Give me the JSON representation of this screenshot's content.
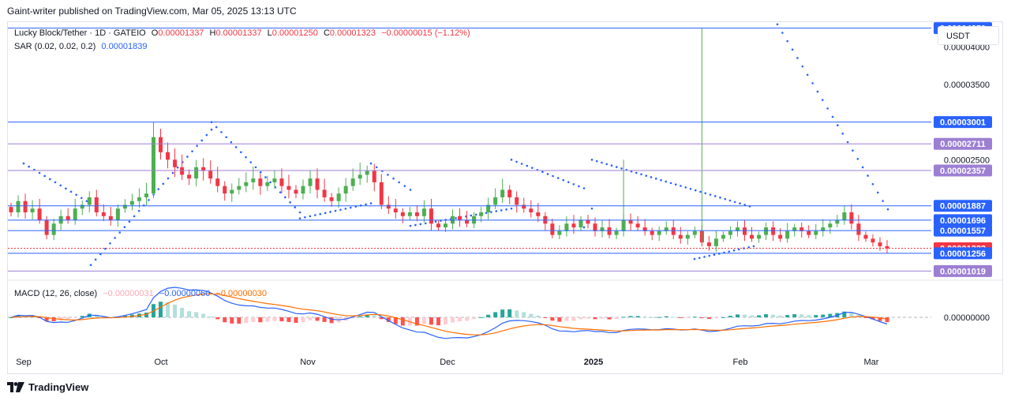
{
  "publisher_line": "Gaint-writer published on TradingView.com, Mar 05, 2025 13:13 UTC",
  "currency": "USDT",
  "brand": "TradingView",
  "colors": {
    "up": "#089981",
    "up_candle": "#4caf50",
    "down": "#f23645",
    "line_blue": "#2962ff",
    "line_purple": "#9c7fd3",
    "macd_line": "#2962ff",
    "signal_line": "#ff6d00",
    "hist_up_strong": "#26a69a",
    "hist_up_weak": "#b2dfdb",
    "hist_down_strong": "#ff5252",
    "hist_down_weak": "#ffcdd2"
  },
  "legend": {
    "symbol": "Lucky Block/Tether · 1D · GATEIO",
    "o_label": "O",
    "o_value": "0.00001337",
    "h_label": "H",
    "h_value": "0.00001337",
    "l_label": "L",
    "l_value": "0.00001250",
    "c_label": "C",
    "c_value": "0.00001323",
    "change": "−0.00000015 (−1.12%)",
    "sar_label": "SAR (0.02, 0.02, 0.2)",
    "sar_value": "0.00001839",
    "macd_label": "MACD (12, 26, close)",
    "macd_hist": "−0.00000031",
    "macd_value": "−0.00000060",
    "signal_value": "−0.00000030"
  },
  "chart_data": [
    {
      "type": "candlestick",
      "symbol": "Lucky Block/Tether",
      "timeframe": "1D",
      "exchange": "GATEIO",
      "x_tick_labels": [
        "Sep",
        "Oct",
        "Nov",
        "Dec",
        "2025",
        "Feb",
        "Mar"
      ],
      "y_tick_labels": [
        "0.00004000",
        "0.00003500",
        "0.00002500"
      ],
      "ylim": [
        9.5e-06,
        4.33e-05
      ],
      "last_ohlc": {
        "open": 1.337e-05,
        "high": 1.337e-05,
        "low": 1.25e-05,
        "close": 1.323e-05
      },
      "horizontal_levels": [
        {
          "value": 4.25e-05,
          "label": "0.00004250",
          "color": "#2962ff"
        },
        {
          "value": 3.001e-05,
          "label": "0.00003001",
          "color": "#2962ff"
        },
        {
          "value": 2.711e-05,
          "label": "0.00002711",
          "color": "#9c7fd3"
        },
        {
          "value": 2.357e-05,
          "label": "0.00002357",
          "color": "#9c7fd3"
        },
        {
          "value": 1.887e-05,
          "label": "0.00001887",
          "color": "#2962ff"
        },
        {
          "value": 1.696e-05,
          "label": "0.00001696",
          "color": "#2962ff"
        },
        {
          "value": 1.557e-05,
          "label": "0.00001557",
          "color": "#2962ff"
        },
        {
          "value": 1.323e-05,
          "label": "0.00001323",
          "color": "#f23645"
        },
        {
          "value": 1.256e-05,
          "label": "0.00001256",
          "color": "#2962ff"
        },
        {
          "value": 1.019e-05,
          "label": "0.00001019",
          "color": "#9c7fd3"
        }
      ],
      "close_series_approx": [
        1.8e-05,
        1.95e-05,
        1.8e-05,
        1.85e-05,
        1.7e-05,
        1.5e-05,
        1.65e-05,
        1.75e-05,
        1.7e-05,
        1.85e-05,
        1.9e-05,
        2e-05,
        1.8e-05,
        1.75e-05,
        1.7e-05,
        1.85e-05,
        1.9e-05,
        1.95e-05,
        2e-05,
        2.05e-05,
        2.8e-05,
        2.6e-05,
        2.5e-05,
        2.4e-05,
        2.3e-05,
        2.25e-05,
        2.4e-05,
        2.35e-05,
        2.25e-05,
        2.15e-05,
        2.05e-05,
        2.1e-05,
        2.15e-05,
        2.2e-05,
        2.25e-05,
        2.15e-05,
        2.2e-05,
        2.25e-05,
        2.15e-05,
        2.1e-05,
        2.05e-05,
        2.15e-05,
        2.25e-05,
        2.1e-05,
        2e-05,
        1.95e-05,
        2.05e-05,
        2.15e-05,
        2.25e-05,
        2.3e-05,
        2.35e-05,
        2.2e-05,
        1.9e-05,
        1.85e-05,
        1.8e-05,
        1.75e-05,
        1.8e-05,
        1.75e-05,
        1.85e-05,
        1.65e-05,
        1.6e-05,
        1.65e-05,
        1.75e-05,
        1.7e-05,
        1.65e-05,
        1.75e-05,
        1.8e-05,
        1.9e-05,
        2e-05,
        2.1e-05,
        2e-05,
        1.9e-05,
        1.85e-05,
        1.8e-05,
        1.75e-05,
        1.65e-05,
        1.5e-05,
        1.55e-05,
        1.65e-05,
        1.6e-05,
        1.7e-05,
        1.65e-05,
        1.55e-05,
        1.6e-05,
        1.5e-05,
        1.55e-05,
        1.7e-05,
        1.65e-05,
        1.6e-05,
        1.55e-05,
        1.5e-05,
        1.55e-05,
        1.6e-05,
        1.5e-05,
        1.45e-05,
        1.5e-05,
        1.55e-05,
        1.4e-05,
        1.35e-05,
        1.45e-05,
        1.5e-05,
        1.55e-05,
        1.6e-05,
        1.5e-05,
        1.45e-05,
        1.5e-05,
        1.6e-05,
        1.5e-05,
        1.45e-05,
        1.55e-05,
        1.6e-05,
        1.55e-05,
        1.5e-05,
        1.55e-05,
        1.6e-05,
        1.65e-05,
        1.7e-05,
        1.8e-05,
        1.65e-05,
        1.5e-05,
        1.45e-05,
        1.4e-05,
        1.35e-05,
        1.32e-05
      ],
      "sar_segments": [
        {
          "from": 2.45e-05,
          "to": 1.95e-05,
          "position": "above"
        },
        {
          "from": 1.1e-05,
          "to": 2.9e-05,
          "position": "below"
        },
        {
          "from": 3e-05,
          "to": 1.8e-05,
          "position": "above"
        },
        {
          "from": 1.72e-05,
          "to": 1.92e-05,
          "position": "below"
        },
        {
          "from": 2.45e-05,
          "to": 2.1e-05,
          "position": "above"
        },
        {
          "from": 1.62e-05,
          "to": 1.85e-05,
          "position": "below"
        },
        {
          "from": 2.5e-05,
          "to": 2.12e-05,
          "position": "above"
        },
        {
          "from": 1.6e-05,
          "to": 1.85e-05,
          "position": "below"
        },
        {
          "from": 2.5e-05,
          "to": 1.88e-05,
          "position": "above"
        },
        {
          "from": 1.18e-05,
          "to": 1.35e-05,
          "position": "below"
        },
        {
          "from": 4.3e-05,
          "to": 1.84e-05,
          "position": "above"
        }
      ]
    },
    {
      "type": "macd",
      "params": "12, 26, close",
      "y_tick_labels": [
        "0.00000000"
      ],
      "zero_line": 0,
      "hist_last": -3.1e-07,
      "macd_last": -6e-07,
      "signal_last": -3e-07
    }
  ]
}
